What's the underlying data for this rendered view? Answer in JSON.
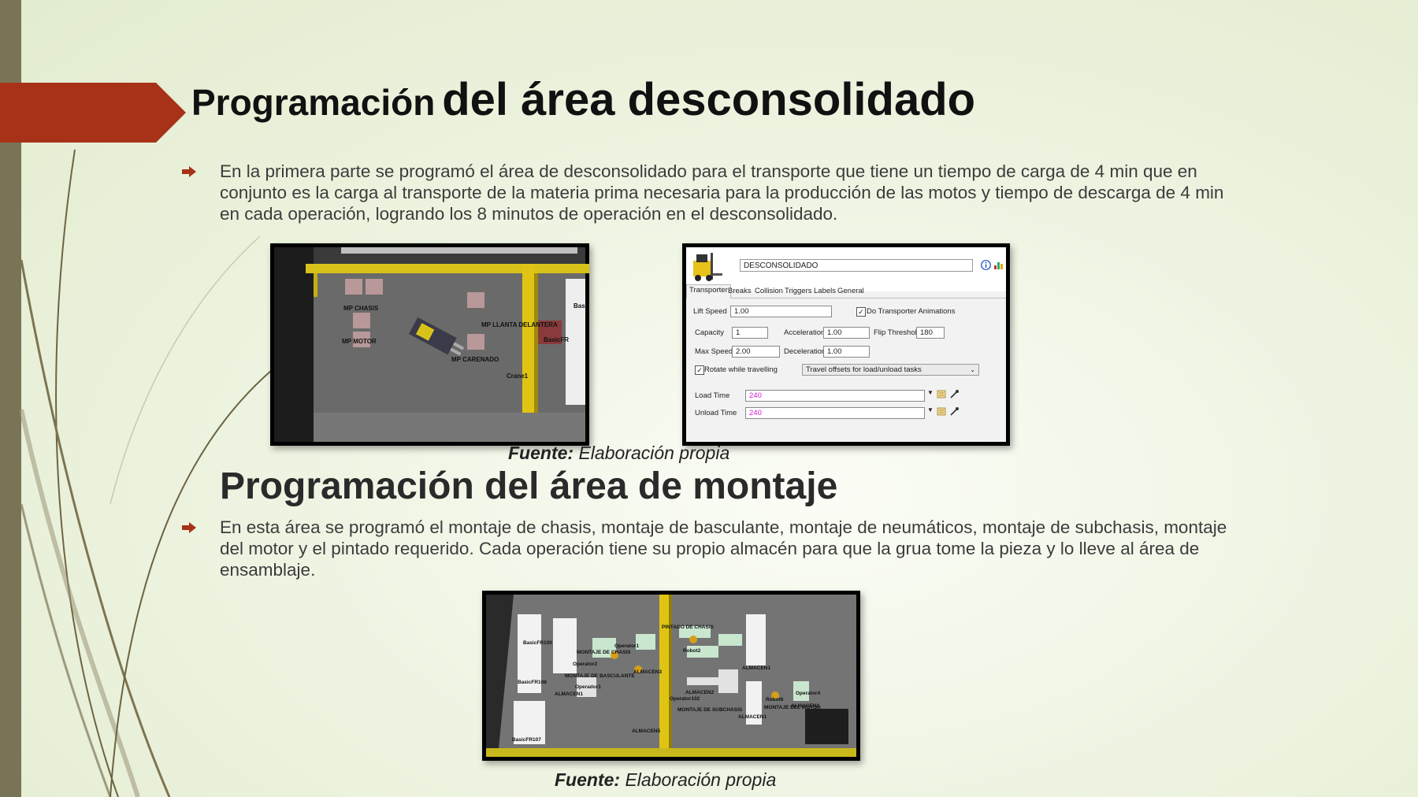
{
  "slide": {
    "title_part1": "Programación",
    "title_part2": "del área desconsolidado",
    "paragraph1": "En la primera parte se programó el área de desconsolidado para el transporte que tiene un tiempo de carga de 4 min que en conjunto es la carga al transporte de la materia prima necesaria para la producción de las motos y tiempo de descarga de 4 min en cada operación, logrando los 8 minutos de operación en el desconsolidado.",
    "caption1_bold": "Fuente:",
    "caption1_text": "Elaboración propia",
    "subtitle": "Programación del área de montaje",
    "paragraph2": "En esta área se programó el montaje de chasis, montaje de basculante, montaje de neumáticos, montaje de subchasis, montaje del motor y el pintado requerido. Cada operación tiene su propio almacén para que la grua tome la pieza y lo lleve al área de ensamblaje.",
    "caption2_bold": "Fuente:",
    "caption2_text": "Elaboración propia",
    "colors": {
      "accent": "#a73218",
      "sidebar": "#7a7456",
      "crane_yellow": "#e8c81a"
    }
  },
  "scene1": {
    "labels": {
      "mp_chasis": "MP CHASIS",
      "mp_motor": "MP MOTOR",
      "mp_llanta": "MP LLANTA DELANTERA",
      "mp_carenado": "MP CARENADO",
      "crane": "Crane1",
      "basic_a": "Bas",
      "basic_b": "BasicFR"
    }
  },
  "props_panel": {
    "name": "DESCONSOLIDADO",
    "tabs": [
      "Transporter",
      "Breaks",
      "Collision",
      "Triggers",
      "Labels",
      "General"
    ],
    "lift_speed_label": "Lift Speed",
    "lift_speed": "1.00",
    "animations_label": "Do Transporter Animations",
    "capacity_label": "Capacity",
    "capacity": "1",
    "acceleration_label": "Acceleration",
    "acceleration": "1.00",
    "flip_label": "Flip Threshold",
    "flip": "180",
    "max_speed_label": "Max Speed",
    "max_speed": "2.00",
    "deceleration_label": "Deceleration",
    "deceleration": "1.00",
    "rotate_label": "Rotate while travelling",
    "offsets_option": "Travel offsets for load/unload tasks",
    "load_time_label": "Load Time",
    "load_time": "240",
    "unload_time_label": "Unload Time",
    "unload_time": "240",
    "icons": [
      "transporter-icon",
      "info-icon",
      "chart-icon",
      "template-icon",
      "eyedropper-icon"
    ]
  },
  "scene2": {
    "labels": {
      "pintado": "PINTADO DE CHASIS",
      "basic1": "BasicFR100",
      "operator1": "Operator1",
      "robot2": "Robot2",
      "montaje_chasis": "MONTAJE DE CHASIS",
      "operator2": "Operator2",
      "almacen3": "ALMACEN3",
      "almacen1": "ALMACEN1",
      "montaje_basculante": "MONTAJE DE BASCULANTE",
      "basic2": "BasicFR108",
      "operador1": "Operador1",
      "almacen_main": "ALMACEN1",
      "almacen2": "ALMACEN2",
      "operator102": "Operator102",
      "montaje_subchasis": "MONTAJE DE SUBCHASIS",
      "operator4": "Operator4",
      "robot6": "Robot6",
      "montaje_motor": "MONTAJE DEL MOTOR",
      "almacen_right": "ALMACEN1",
      "almacen_low": "ALMACEN1",
      "almacen5": "ALMACEN5",
      "basic3": "BasicFR107"
    }
  }
}
